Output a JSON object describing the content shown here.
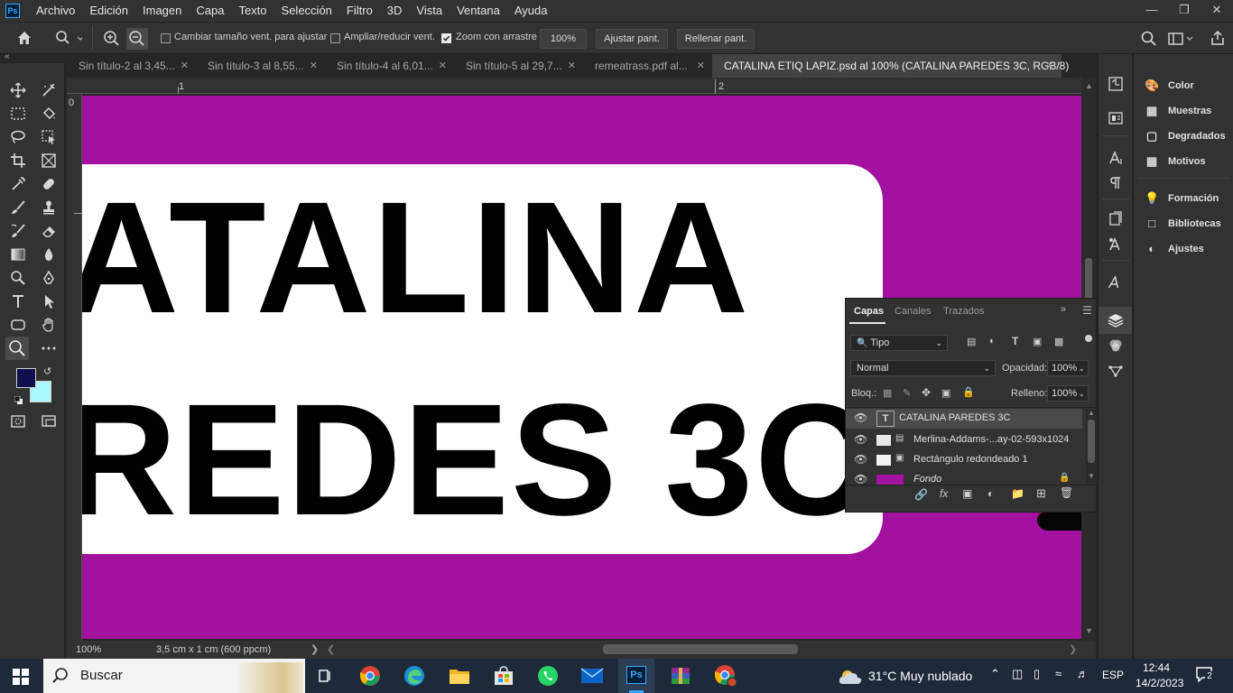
{
  "menubar": {
    "logo": "Ps",
    "items": [
      "Archivo",
      "Edición",
      "Imagen",
      "Capa",
      "Texto",
      "Selección",
      "Filtro",
      "3D",
      "Vista",
      "Ventana",
      "Ayuda"
    ]
  },
  "options": {
    "resize_windows": "Cambiar tamaño vent. para ajustar",
    "zoom_all": "Ampliar/reducir vent.",
    "scrubby_zoom": "Zoom con arrastre",
    "zoom_value": "100%",
    "fit_screen": "Ajustar pant.",
    "fill_screen": "Rellenar pant."
  },
  "tabs": [
    {
      "label": "Sin título-2 al 3,45..."
    },
    {
      "label": "Sin título-3 al 8,55..."
    },
    {
      "label": "Sin título-4 al 6,01..."
    },
    {
      "label": "Sin título-5 al 29,7..."
    },
    {
      "label": "remeatrass.pdf al..."
    },
    {
      "label": "CATALINA ETIQ LAPIZ.psd al 100% (CATALINA PAREDES 3C, RGB/8)"
    }
  ],
  "rulers": {
    "h_marks": [
      "1",
      "2"
    ],
    "v_marks": [
      "0"
    ]
  },
  "canvas": {
    "line1": "ATALINA",
    "line2": "REDES 3C",
    "bg_color": "#a2119f"
  },
  "status": {
    "zoom": "100%",
    "doc_info": "3,5 cm x 1 cm (600 ppcm)"
  },
  "right_panel": [
    {
      "icon": "color-icon",
      "label": "Color"
    },
    {
      "icon": "swatches-icon",
      "label": "Muestras"
    },
    {
      "icon": "gradients-icon",
      "label": "Degradados"
    },
    {
      "icon": "patterns-icon",
      "label": "Motivos"
    },
    {
      "icon": "learn-icon",
      "label": "Formación"
    },
    {
      "icon": "libraries-icon",
      "label": "Bibliotecas"
    },
    {
      "icon": "adjustments-icon",
      "label": "Ajustes"
    }
  ],
  "layers_panel": {
    "tabs": [
      "Capas",
      "Canales",
      "Trazados"
    ],
    "filter": "Tipo",
    "blend_mode": "Normal",
    "opacity_label": "Opacidad:",
    "opacity": "100%",
    "lock_label": "Bloq.:",
    "fill_label": "Relleno:",
    "fill": "100%",
    "layers": [
      {
        "name": "CATALINA PAREDES 3C",
        "kind": "text"
      },
      {
        "name": "Merlina-Addams-...ay-02-593x1024",
        "kind": "smart"
      },
      {
        "name": "Rectángulo redondeado 1",
        "kind": "shape"
      },
      {
        "name": "Fondo",
        "kind": "background"
      }
    ]
  },
  "taskbar": {
    "search_placeholder": "Buscar",
    "weather": "31°C  Muy nublado",
    "lang": "ESP",
    "time": "12:44",
    "date": "14/2/2023",
    "notifications": "2"
  }
}
